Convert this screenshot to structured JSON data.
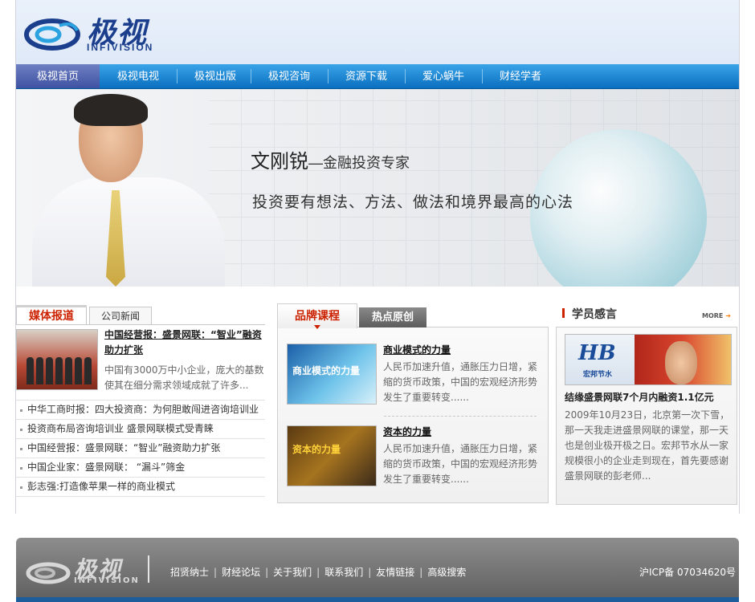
{
  "header": {
    "logo_text": "极视",
    "logo_sub": "INFIVISION"
  },
  "nav": {
    "items": [
      {
        "label": "极视首页",
        "active": true
      },
      {
        "label": "极视电视"
      },
      {
        "label": "极视出版"
      },
      {
        "label": "极视咨询"
      },
      {
        "label": "资源下载"
      },
      {
        "label": "爱心蜗牛"
      },
      {
        "label": "财经学者"
      }
    ]
  },
  "banner": {
    "name": "文刚锐",
    "title": "—金融投资专家",
    "slogan": "投资要有想法、方法、做法和境界最高的心法"
  },
  "media": {
    "tab_active": "媒体报道",
    "tab_other": "公司新闻",
    "featured": {
      "title": "中国经营报：盛景网联：“智业”融资助力扩张",
      "text": "中国有3000万中小企业，庞大的基数使其在细分需求领域成就了许多..."
    },
    "list": [
      "中华工商时报：四大投资商：为何胆敢闯进咨询培训业",
      "投资商布局咨询培训业 盛景网联模式受青睐",
      "中国经营报：盛景网联：“智业”融资助力扩张",
      "中国企业家：盛景网联： “漏斗”筛金",
      "彭志强:打造像苹果一样的商业模式"
    ]
  },
  "courses": {
    "tab_active": "品牌课程",
    "tab_other": "热点原创",
    "items": [
      {
        "image_label": "商业模式的力量",
        "title": "商业模式的力量",
        "text": "人民币加速升值，通胀压力日增，紧缩的货币政策，中国的宏观经济形势发生了重要转变......"
      },
      {
        "image_label": "资本的力量",
        "title": "资本的力量",
        "text": "人民币加速升值，通胀压力日增，紧缩的货币政策，中国的宏观经济形势发生了重要转变......"
      }
    ]
  },
  "testimonials": {
    "heading": "学员感言",
    "more": "MORE",
    "logo_letters": "HB",
    "logo_caption": "宏邦节水",
    "title": "结缘盛景网联7个月内融资1.1亿元",
    "text": "2009年10月23日，北京第一次下雪，那一天我走进盛景网联的课堂，那一天也是创业极开极之日。宏邦节水从一家规模很小的企业走到现在，首先要感谢盛景网联的彭老师..."
  },
  "footer": {
    "logo_text": "极视",
    "logo_sub": "INFIVISION",
    "links": [
      "招贤纳士",
      "财经论坛",
      "关于我们",
      "联系我们",
      "友情链接",
      "高级搜索"
    ],
    "icp": "沪ICP备 07034620号"
  },
  "colors": {
    "nav_blue": "#0a6fc0",
    "accent_red": "#cc2200",
    "brand_blue": "#1b3f8c"
  }
}
